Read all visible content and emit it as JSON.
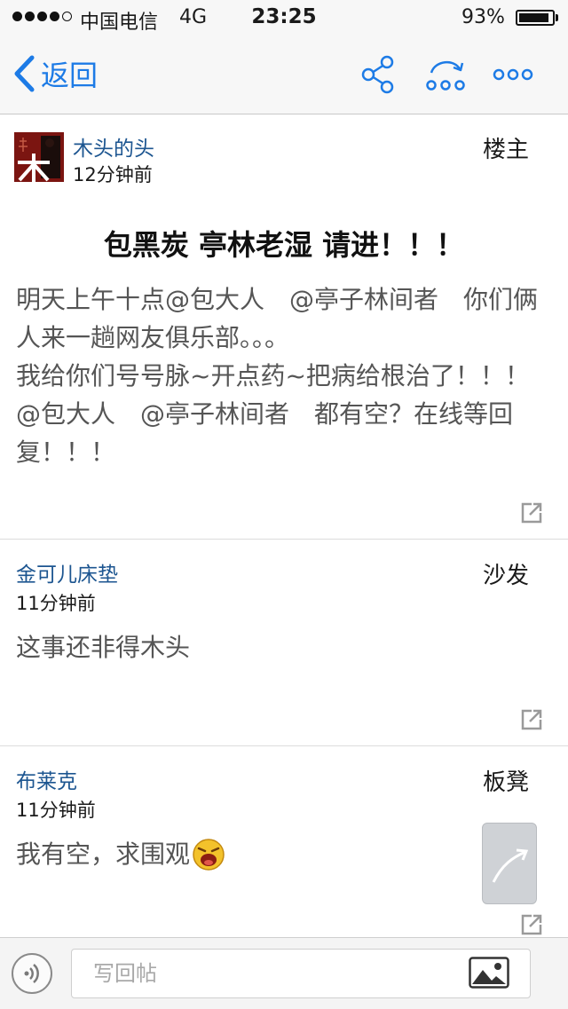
{
  "status_bar": {
    "carrier": "中国电信",
    "network": "4G",
    "time": "23:25",
    "battery_percent": "93%",
    "battery_level": 0.93,
    "signal_bars": 4,
    "signal_max": 5
  },
  "nav": {
    "back_label": "返回",
    "icons": [
      "share-icon",
      "forward-icon",
      "more-icon"
    ]
  },
  "main_post": {
    "author": "木头的头",
    "time": "12分钟前",
    "floor": "楼主",
    "title": "包黑炭 亭林老湿 请进！！！",
    "lines": [
      "明天上午十点@包大人　@亭子林间者　你们俩人来一趟网友俱乐部。。。",
      "我给你们号号脉~开点药~把病给根治了！！！",
      "@包大人　@亭子林间者　都有空？在线等回复！！！"
    ]
  },
  "replies": [
    {
      "author": "金可儿床垫",
      "time": "11分钟前",
      "floor": "沙发",
      "text": "这事还非得木头"
    },
    {
      "author": "布莱克",
      "time": "11分钟前",
      "floor": "板凳",
      "text": "我有空，求围观"
    }
  ],
  "reply_bar": {
    "placeholder": "写回帖"
  },
  "colors": {
    "accent": "#1d7be6",
    "author": "#1c5590",
    "body_text": "#555555"
  }
}
